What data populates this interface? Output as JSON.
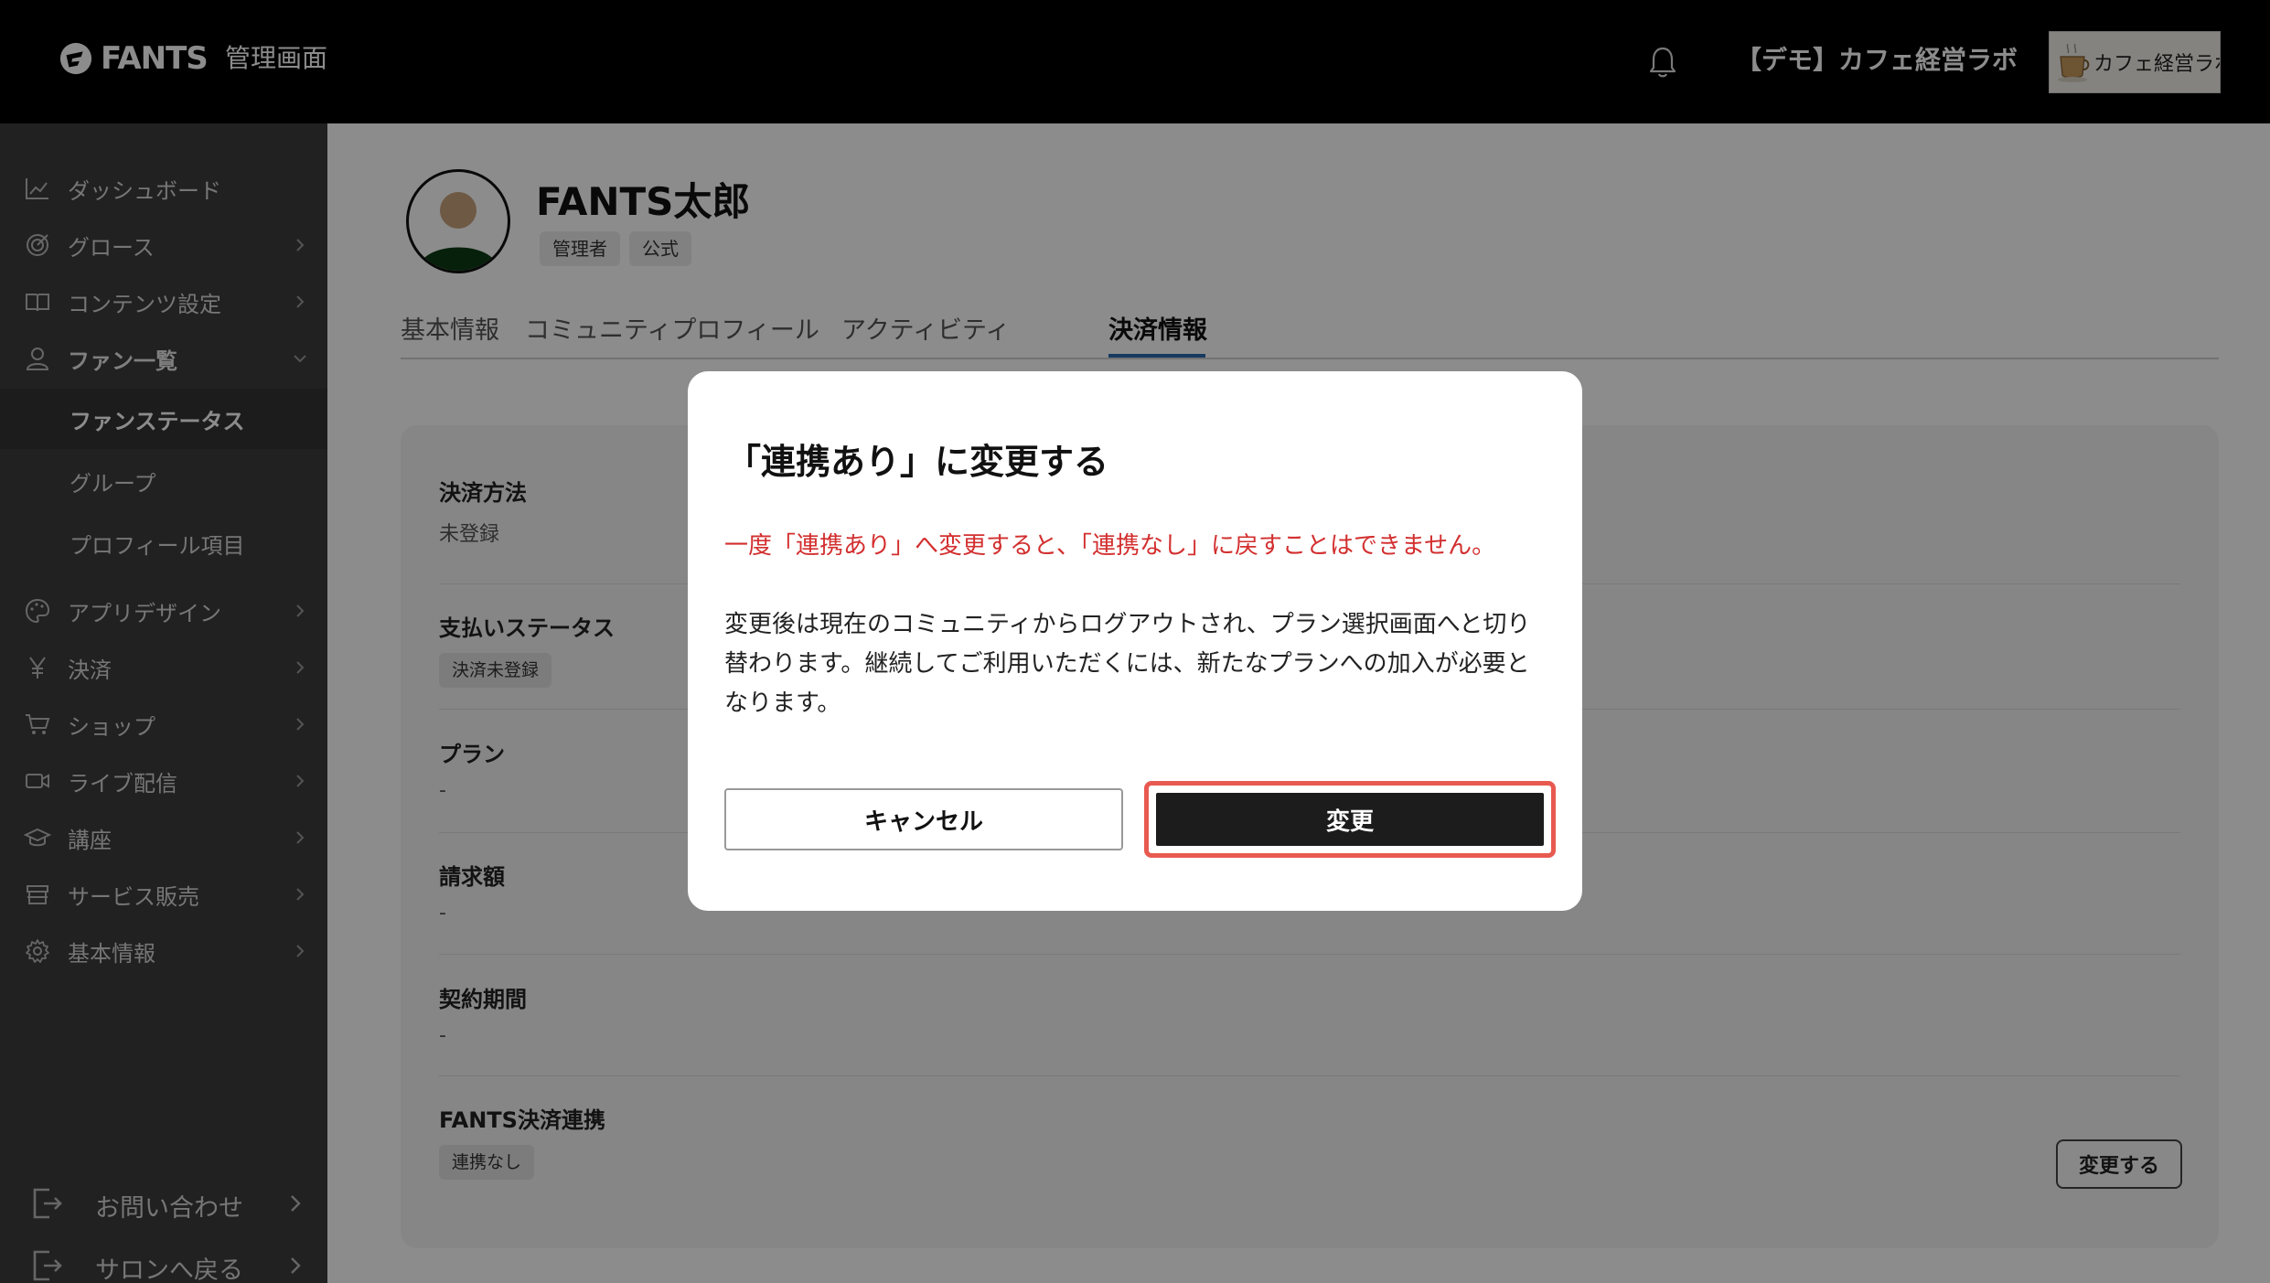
{
  "header": {
    "logo_text": "FANTS",
    "title": "管理画面",
    "community_name": "【デモ】カフェ経営ラボ",
    "community_thumb_text": "カフェ経営ラボ"
  },
  "sidebar": {
    "items": [
      {
        "label": "ダッシュボード",
        "icon": "chart-line-icon"
      },
      {
        "label": "グロース",
        "icon": "target-icon"
      },
      {
        "label": "コンテンツ設定",
        "icon": "book-icon"
      },
      {
        "label": "ファン一覧",
        "icon": "user-icon"
      },
      {
        "label": "アプリデザイン",
        "icon": "palette-icon"
      },
      {
        "label": "決済",
        "icon": "yen-icon"
      },
      {
        "label": "ショップ",
        "icon": "cart-icon"
      },
      {
        "label": "ライブ配信",
        "icon": "video-icon"
      },
      {
        "label": "講座",
        "icon": "graduation-cap-icon"
      },
      {
        "label": "サービス販売",
        "icon": "store-icon"
      },
      {
        "label": "基本情報",
        "icon": "gear-icon"
      }
    ],
    "sub_items": [
      "ファンステータス",
      "グループ",
      "プロフィール項目"
    ],
    "bottom": [
      "お問い合わせ",
      "サロンへ戻る"
    ]
  },
  "profile": {
    "name": "FANTS太郎",
    "badges": [
      "管理者",
      "公式"
    ]
  },
  "tabs": [
    "基本情報",
    "コミュニティプロフィール",
    "アクティビティ",
    "決済情報"
  ],
  "payment": {
    "method_label": "決済方法",
    "method_value": "未登録",
    "status_label": "支払いステータス",
    "status_value": "決済未登録",
    "plan_label": "プラン",
    "plan_value": "-",
    "amount_label": "請求額",
    "amount_value": "-",
    "period_label": "契約期間",
    "period_value": "-",
    "fants_label": "FANTS決済連携",
    "fants_value": "連携なし",
    "change_button": "変更する"
  },
  "modal": {
    "title": "「連携あり」に変更する",
    "warning": "一度「連携あり」へ変更すると、「連携なし」に戻すことはできません。",
    "body": "変更後は現在のコミュニティからログアウトされ、プラン選択画面へと切り替わります。継続してご利用いただくには、新たなプランへの加入が必要となります。",
    "cancel": "キャンセル",
    "confirm": "変更"
  },
  "colors": {
    "header_bg": "#000000",
    "sidebar_bg": "#3c3c3c",
    "tab_underline": "#2b6cb0",
    "warning": "#d32f2f",
    "highlight": "#e85a50"
  }
}
